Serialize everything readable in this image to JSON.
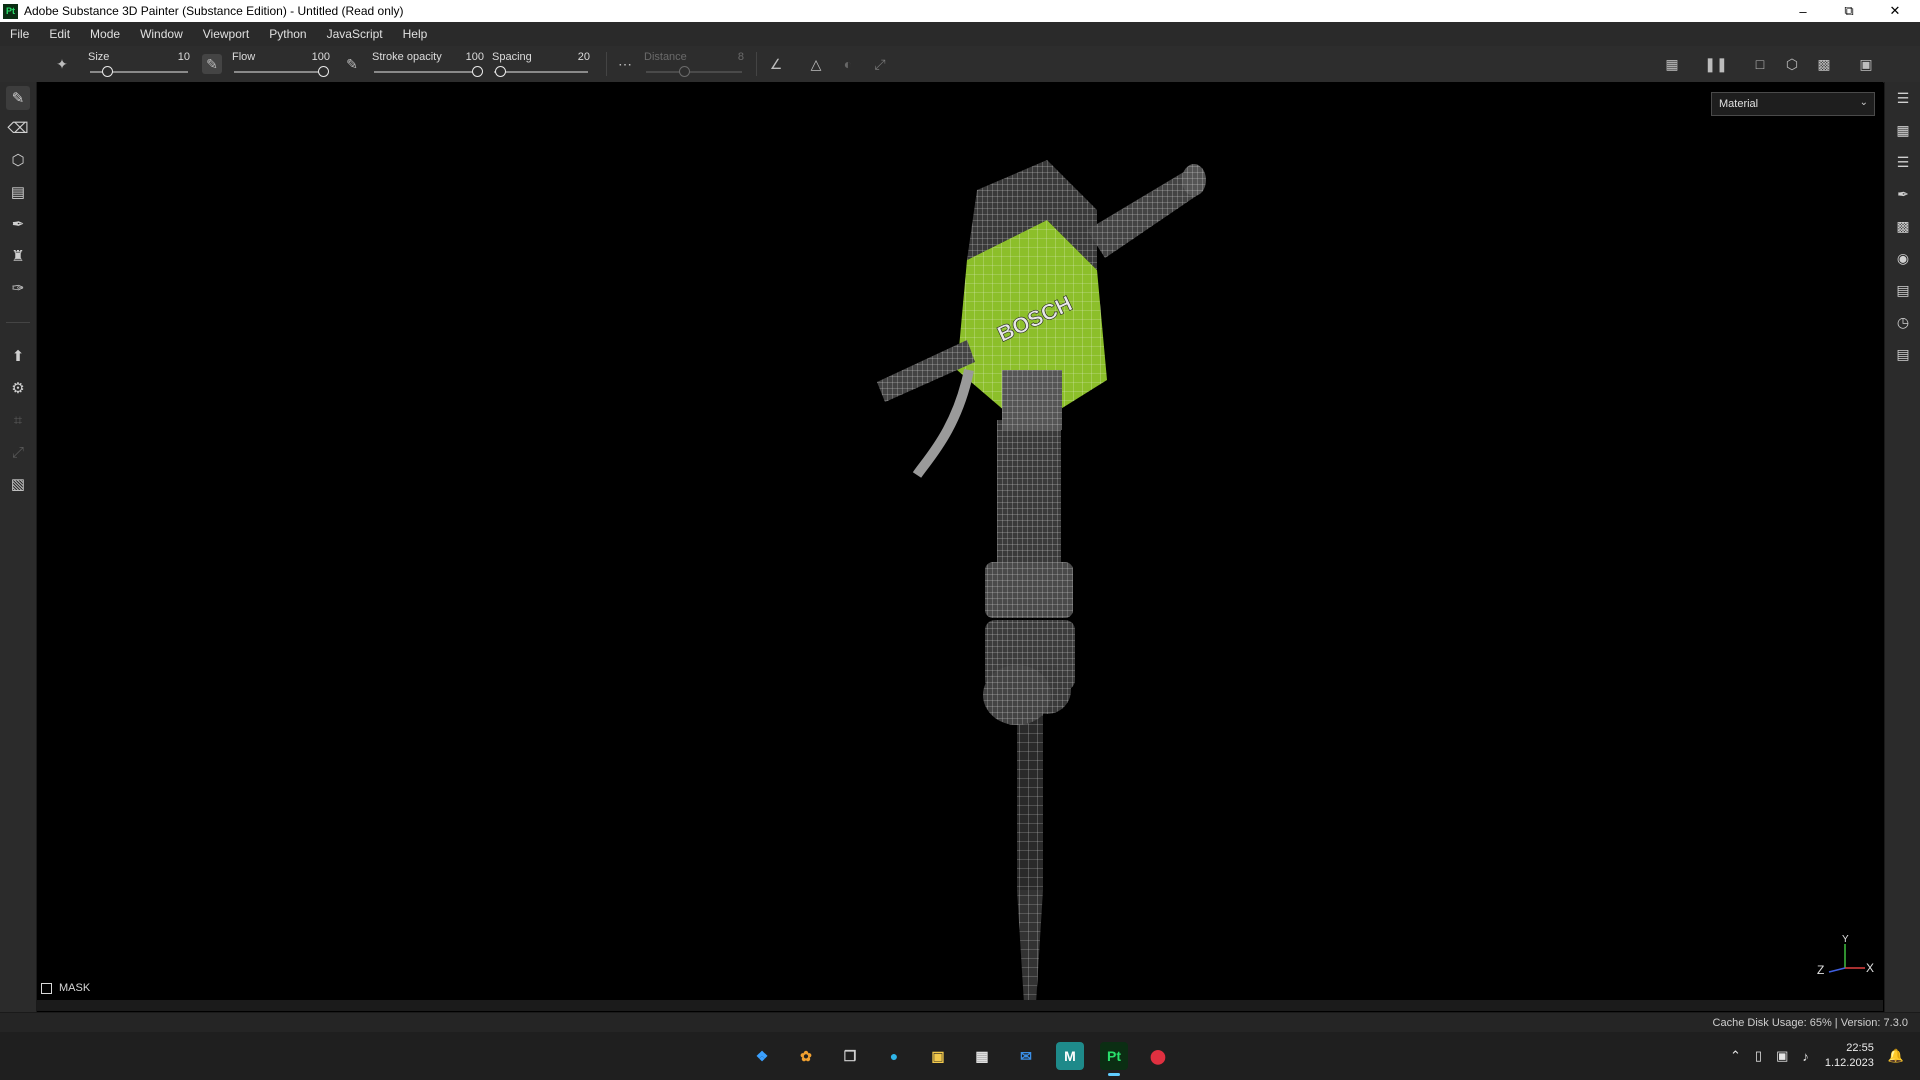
{
  "window": {
    "logo": "Pt",
    "title": "Adobe Substance 3D Painter (Substance Edition) - Untitled (Read only)",
    "controls": [
      "minimize-icon",
      "restore-icon",
      "close-icon"
    ]
  },
  "menu": [
    "File",
    "Edit",
    "Mode",
    "Window",
    "Viewport",
    "Python",
    "JavaScript",
    "Help"
  ],
  "toolbar": {
    "size": {
      "label": "Size",
      "value": "10",
      "level": 0.15
    },
    "flow": {
      "label": "Flow",
      "value": "100",
      "level": 1.0
    },
    "stroke_opacity": {
      "label": "Stroke opacity",
      "value": "100",
      "level": 1.0
    },
    "spacing": {
      "label": "Spacing",
      "value": "20",
      "level": 0.03
    },
    "distance": {
      "label": "Distance",
      "value": "8",
      "level": 0.4,
      "enabled": false
    },
    "icons": [
      "brush-preset-icon",
      "alpha-icon",
      "lazy-mouse-icon",
      "angle-icon",
      "symmetry-icon",
      "mirror-icon",
      "transform-icon",
      "hide-ui-icon",
      "pause-icon",
      "2d-view-icon",
      "3d-view-icon",
      "camera-icon",
      "screenshot-icon"
    ]
  },
  "left_tools": [
    "paint-brush-icon",
    "eraser-icon",
    "projection-icon",
    "polygon-fill-icon",
    "smudge-icon",
    "clone-stamp-icon",
    "color-picker-icon",
    "bake-icon",
    "material-picker-icon",
    "geometry-mask-icon",
    "uv-icon",
    "export-icon"
  ],
  "right_tools": [
    "layers-icon",
    "texture-set-icon",
    "properties-icon",
    "brush-settings-icon",
    "display-settings-icon",
    "shader-icon",
    "assets-icon",
    "history-icon",
    "log-icon"
  ],
  "viewport": {
    "channel": "Material",
    "mask_label": "MASK",
    "brand_text": "BOSCH",
    "axes": {
      "y": "Y",
      "x": "X",
      "z": "Z"
    },
    "accent": "#8cbf2a"
  },
  "status": {
    "text": "Cache Disk Usage:   65% | Version: 7.3.0"
  },
  "taskbar": {
    "apps": [
      {
        "icon": "windows-start-icon",
        "label": ""
      },
      {
        "icon": "copilot-icon",
        "label": ""
      },
      {
        "icon": "task-view-icon",
        "label": ""
      },
      {
        "icon": "edge-icon",
        "label": ""
      },
      {
        "icon": "file-explorer-icon",
        "label": ""
      },
      {
        "icon": "store-icon",
        "label": ""
      },
      {
        "icon": "mail-icon",
        "label": ""
      },
      {
        "icon": "maya-icon",
        "label": "M"
      },
      {
        "icon": "substance-painter-icon",
        "label": "Pt"
      },
      {
        "icon": "app-icon",
        "label": ""
      }
    ],
    "time": "22:55",
    "date": "1.12.2023"
  }
}
